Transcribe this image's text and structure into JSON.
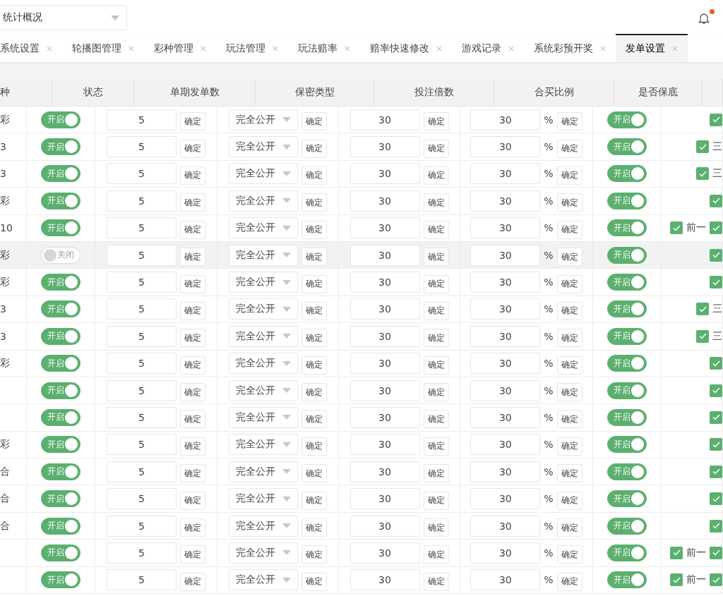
{
  "top_bar": {
    "menu_select": {
      "value": "统计概况"
    },
    "notification": {
      "unread": true
    }
  },
  "tabs": [
    {
      "label": "系统设置",
      "selected": false
    },
    {
      "label": "轮播图管理",
      "selected": false
    },
    {
      "label": "彩种管理",
      "selected": false
    },
    {
      "label": "玩法管理",
      "selected": false
    },
    {
      "label": "玩法赔率",
      "selected": false
    },
    {
      "label": "赔率快速修改",
      "selected": false
    },
    {
      "label": "游戏记录",
      "selected": false
    },
    {
      "label": "系统彩预开奖",
      "selected": false
    },
    {
      "label": "发单设置",
      "selected": true
    }
  ],
  "table": {
    "columns": [
      "种",
      "状态",
      "单期发单数",
      "保密类型",
      "投注倍数",
      "合买比例",
      "是否保底"
    ],
    "rows": [
      {
        "name": "彩",
        "highlighted": false,
        "status": {
          "on": true,
          "label": "开启"
        },
        "count": "5",
        "secrecy": "完全公开",
        "multiple": "30",
        "ratio": "30",
        "percent": "%",
        "guarantee": {
          "on": true,
          "label": "开启"
        },
        "confirm_buttons": [
          "确定",
          "确定",
          "确定",
          "确定"
        ],
        "options": [
          {
            "checked": true
          }
        ]
      },
      {
        "name": "3",
        "highlighted": false,
        "status": {
          "on": true,
          "label": "开启"
        },
        "count": "5",
        "secrecy": "完全公开",
        "multiple": "30",
        "ratio": "30",
        "percent": "%",
        "guarantee": {
          "on": true,
          "label": "开启"
        },
        "confirm_buttons": [
          "确定",
          "确定",
          "确定",
          "确定"
        ],
        "options": [
          {
            "checked": true,
            "label": "三"
          }
        ]
      },
      {
        "name": "3",
        "highlighted": false,
        "status": {
          "on": true,
          "label": "开启"
        },
        "count": "5",
        "secrecy": "完全公开",
        "multiple": "30",
        "ratio": "30",
        "percent": "%",
        "guarantee": {
          "on": true,
          "label": "开启"
        },
        "confirm_buttons": [
          "确定",
          "确定",
          "确定",
          "确定"
        ],
        "options": [
          {
            "checked": true,
            "label": "三"
          }
        ]
      },
      {
        "name": "彩",
        "highlighted": false,
        "status": {
          "on": true,
          "label": "开启"
        },
        "count": "5",
        "secrecy": "完全公开",
        "multiple": "30",
        "ratio": "30",
        "percent": "%",
        "guarantee": {
          "on": true,
          "label": "开启"
        },
        "confirm_buttons": [
          "确定",
          "确定",
          "确定",
          "确定"
        ],
        "options": [
          {
            "checked": true
          }
        ]
      },
      {
        "name": "10",
        "highlighted": false,
        "status": {
          "on": true,
          "label": "开启"
        },
        "count": "5",
        "secrecy": "完全公开",
        "multiple": "30",
        "ratio": "30",
        "percent": "%",
        "guarantee": {
          "on": true,
          "label": "开启"
        },
        "confirm_buttons": [
          "确定",
          "确定",
          "确定",
          "确定"
        ],
        "options": [
          {
            "checked": true,
            "label": "前一"
          },
          {
            "checked": true
          }
        ]
      },
      {
        "name": "彩",
        "highlighted": true,
        "status": {
          "on": false,
          "label": "关闭"
        },
        "count": "5",
        "secrecy": "完全公开",
        "multiple": "30",
        "ratio": "30",
        "percent": "%",
        "guarantee": {
          "on": true,
          "label": "开启"
        },
        "confirm_buttons": [
          "确定",
          "确定",
          "确定",
          "确定"
        ],
        "options": [
          {
            "checked": true
          }
        ]
      },
      {
        "name": "彩",
        "highlighted": false,
        "status": {
          "on": true,
          "label": "开启"
        },
        "count": "5",
        "secrecy": "完全公开",
        "multiple": "30",
        "ratio": "30",
        "percent": "%",
        "guarantee": {
          "on": true,
          "label": "开启"
        },
        "confirm_buttons": [
          "确定",
          "确定",
          "确定",
          "确定"
        ],
        "options": [
          {
            "checked": true
          }
        ]
      },
      {
        "name": "3",
        "highlighted": false,
        "status": {
          "on": true,
          "label": "开启"
        },
        "count": "5",
        "secrecy": "完全公开",
        "multiple": "30",
        "ratio": "30",
        "percent": "%",
        "guarantee": {
          "on": true,
          "label": "开启"
        },
        "confirm_buttons": [
          "确定",
          "确定",
          "确定",
          "确定"
        ],
        "options": [
          {
            "checked": true,
            "label": "三"
          }
        ]
      },
      {
        "name": "3",
        "highlighted": false,
        "status": {
          "on": true,
          "label": "开启"
        },
        "count": "5",
        "secrecy": "完全公开",
        "multiple": "30",
        "ratio": "30",
        "percent": "%",
        "guarantee": {
          "on": true,
          "label": "开启"
        },
        "confirm_buttons": [
          "确定",
          "确定",
          "确定",
          "确定"
        ],
        "options": [
          {
            "checked": true,
            "label": "三"
          }
        ]
      },
      {
        "name": "彩",
        "highlighted": false,
        "status": {
          "on": true,
          "label": "开启"
        },
        "count": "5",
        "secrecy": "完全公开",
        "multiple": "30",
        "ratio": "30",
        "percent": "%",
        "guarantee": {
          "on": true,
          "label": "开启"
        },
        "confirm_buttons": [
          "确定",
          "确定",
          "确定",
          "确定"
        ],
        "options": [
          {
            "checked": true
          }
        ]
      },
      {
        "highlighted": false,
        "status": {
          "on": true,
          "label": "开启"
        },
        "count": "5",
        "secrecy": "完全公开",
        "multiple": "30",
        "ratio": "30",
        "percent": "%",
        "guarantee": {
          "on": true,
          "label": "开启"
        },
        "confirm_buttons": [
          "确定",
          "确定",
          "确定",
          "确定"
        ],
        "options": [
          {
            "checked": true
          }
        ]
      },
      {
        "highlighted": false,
        "status": {
          "on": true,
          "label": "开启"
        },
        "count": "5",
        "secrecy": "完全公开",
        "multiple": "30",
        "ratio": "30",
        "percent": "%",
        "guarantee": {
          "on": true,
          "label": "开启"
        },
        "confirm_buttons": [
          "确定",
          "确定",
          "确定",
          "确定"
        ],
        "options": [
          {
            "checked": true
          }
        ]
      },
      {
        "name": "彩",
        "highlighted": false,
        "status": {
          "on": true,
          "label": "开启"
        },
        "count": "5",
        "secrecy": "完全公开",
        "multiple": "30",
        "ratio": "30",
        "percent": "%",
        "guarantee": {
          "on": true,
          "label": "开启"
        },
        "confirm_buttons": [
          "确定",
          "确定",
          "确定",
          "确定"
        ],
        "options": [
          {
            "checked": true
          }
        ]
      },
      {
        "name": "合",
        "highlighted": false,
        "status": {
          "on": true,
          "label": "开启"
        },
        "count": "5",
        "secrecy": "完全公开",
        "multiple": "30",
        "ratio": "30",
        "percent": "%",
        "guarantee": {
          "on": true,
          "label": "开启"
        },
        "confirm_buttons": [
          "确定",
          "确定",
          "确定",
          "确定"
        ],
        "options": [
          {
            "checked": true
          }
        ]
      },
      {
        "name": "合",
        "highlighted": false,
        "status": {
          "on": true,
          "label": "开启"
        },
        "count": "5",
        "secrecy": "完全公开",
        "multiple": "30",
        "ratio": "30",
        "percent": "%",
        "guarantee": {
          "on": true,
          "label": "开启"
        },
        "confirm_buttons": [
          "确定",
          "确定",
          "确定",
          "确定"
        ],
        "options": [
          {
            "checked": true
          }
        ]
      },
      {
        "name": "合",
        "highlighted": false,
        "status": {
          "on": true,
          "label": "开启"
        },
        "count": "5",
        "secrecy": "完全公开",
        "multiple": "30",
        "ratio": "30",
        "percent": "%",
        "guarantee": {
          "on": true,
          "label": "开启"
        },
        "confirm_buttons": [
          "确定",
          "确定",
          "确定",
          "确定"
        ],
        "options": [
          {
            "checked": true
          }
        ]
      },
      {
        "highlighted": false,
        "status": {
          "on": true,
          "label": "开启"
        },
        "count": "5",
        "secrecy": "完全公开",
        "multiple": "30",
        "ratio": "30",
        "percent": "%",
        "guarantee": {
          "on": true,
          "label": "开启"
        },
        "confirm_buttons": [
          "确定",
          "确定",
          "确定",
          "确定"
        ],
        "options": [
          {
            "checked": true,
            "label": "前一"
          },
          {
            "checked": true
          }
        ]
      },
      {
        "highlighted": false,
        "status": {
          "on": true,
          "label": "开启"
        },
        "count": "5",
        "secrecy": "完全公开",
        "multiple": "30",
        "ratio": "30",
        "percent": "%",
        "guarantee": {
          "on": true,
          "label": "开启"
        },
        "confirm_buttons": [
          "确定",
          "确定",
          "确定",
          "确定"
        ],
        "options": [
          {
            "checked": true,
            "label": "前一"
          },
          {
            "checked": true
          }
        ]
      }
    ]
  }
}
